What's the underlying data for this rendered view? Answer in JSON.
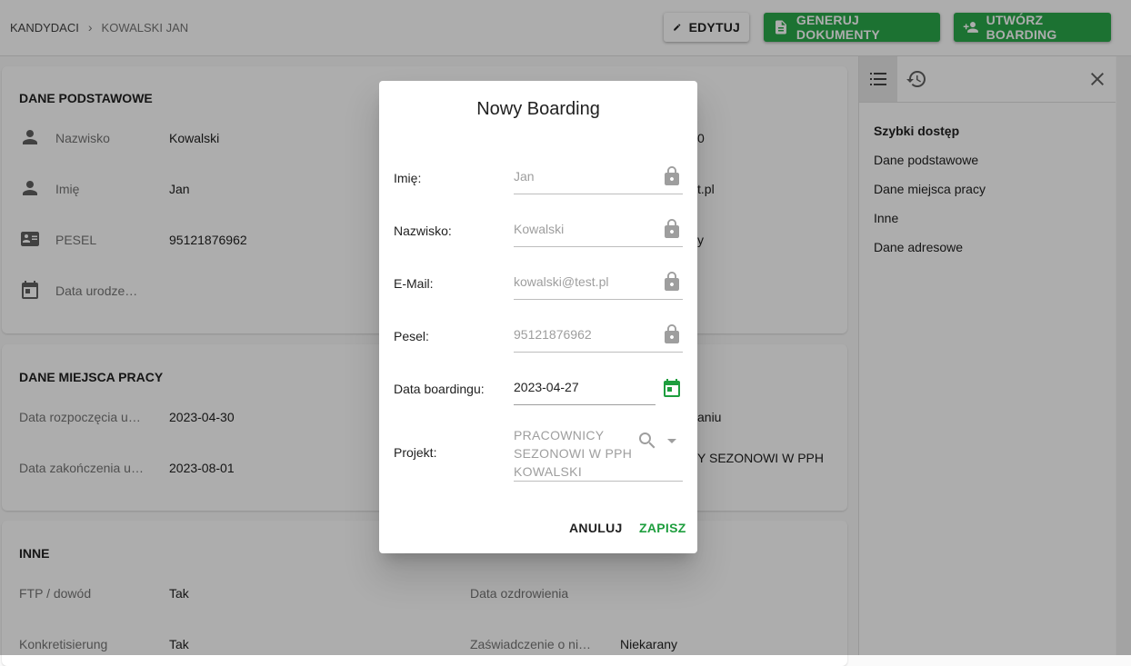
{
  "breadcrumb": {
    "parent": "KANDYDACI",
    "current": "KOWALSKI JAN"
  },
  "toolbar": {
    "edit": "EDYTUJ",
    "generate": "GENERUJ DOKUMENTY",
    "boarding": "UTWÓRZ BOARDING"
  },
  "basic": {
    "title": "DANE PODSTAWOWE",
    "surname_label": "Nazwisko",
    "surname": "Kowalski",
    "name_label": "Imię",
    "name": "Jan",
    "pesel_label": "PESEL",
    "pesel": "95121876962",
    "birth_label": "Data urodze…",
    "right_phone_tail": "0",
    "right_email_tail": "t.pl",
    "right_third_tail": "y"
  },
  "work": {
    "title": "DANE MIEJSCA PRACY",
    "start_label": "Data rozpoczęcia u…",
    "start": "2023-04-30",
    "end_label": "Data zakończenia u…",
    "end": "2023-08-01",
    "right1_tail": "aniu",
    "right2_tail": "Y SEZONOWI W PPH"
  },
  "other": {
    "title": "INNE",
    "ftp_label": "FTP / dowód",
    "ftp": "Tak",
    "recovery_label": "Data ozdrowienia",
    "konkret_label": "Konkretisierung",
    "konkret": "Tak",
    "cert_label": "Zaświadczenie o ni…",
    "cert": "Niekarany"
  },
  "sidebar": {
    "title": "Szybki dostęp",
    "items": [
      "Dane podstawowe",
      "Dane miejsca pracy",
      "Inne",
      "Dane adresowe"
    ]
  },
  "dialog": {
    "title": "Nowy Boarding",
    "name_label": "Imię:",
    "name": "Jan",
    "surname_label": "Nazwisko:",
    "surname": "Kowalski",
    "email_label": "E-Mail:",
    "email": "kowalski@test.pl",
    "pesel_label": "Pesel:",
    "pesel": "95121876962",
    "date_label": "Data boardingu:",
    "date": "2023-04-27",
    "project_label": "Projekt:",
    "project": "PRACOWNICY SEZONOWI W PPH KOWALSKI",
    "cancel": "ANULUJ",
    "save": "ZAPISZ"
  },
  "colors": {
    "accent": "#2aa84a",
    "accent_dark": "#1e9e3e"
  }
}
